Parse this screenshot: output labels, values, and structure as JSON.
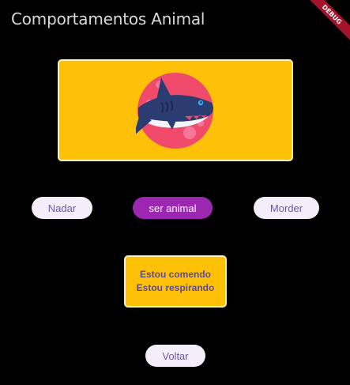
{
  "appbar": {
    "title": "Comportamentos Animal",
    "debug_label": "DEBUG"
  },
  "image": {
    "icon": "shark-icon"
  },
  "actions": {
    "swim_label": "Nadar",
    "animal_label": "ser animal",
    "bite_label": "Morder"
  },
  "status": {
    "lines": [
      "Estou comendo",
      "Estou respirando"
    ]
  },
  "footer": {
    "back_label": "Voltar"
  },
  "colors": {
    "background": "#000000",
    "card": "#ffc107",
    "active": "#9c27b0",
    "pill": "#f3eef9",
    "pill_text": "#6a58a8",
    "shark_bg": "#f04b6b"
  }
}
